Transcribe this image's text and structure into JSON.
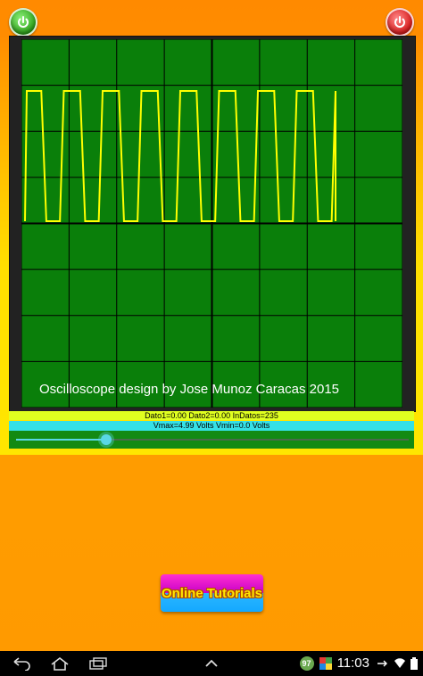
{
  "app": {
    "credit_text": "Oscilloscope design by Jose Munoz Caracas 2015",
    "info_line1": "Dato1=0.00 Dato2=0.00 InDatos=235",
    "info_line2": "Vmax=4.99 Volts Vmin=0.0 Volts",
    "tutorial_label": "Online Tutorials",
    "slider_value": 0.23
  },
  "waveform": {
    "cycles": 8,
    "color": "#ffff00",
    "grid_color": "#000000",
    "background": "#0a7f0a"
  },
  "status_bar": {
    "time": "11:03",
    "badge": "97"
  },
  "icons": {
    "left_power": "power-icon-green",
    "right_power": "power-icon-red",
    "nav_back": "back-icon",
    "nav_home": "home-icon",
    "nav_recents": "recents-icon",
    "nav_menu": "chevron-up-icon"
  }
}
